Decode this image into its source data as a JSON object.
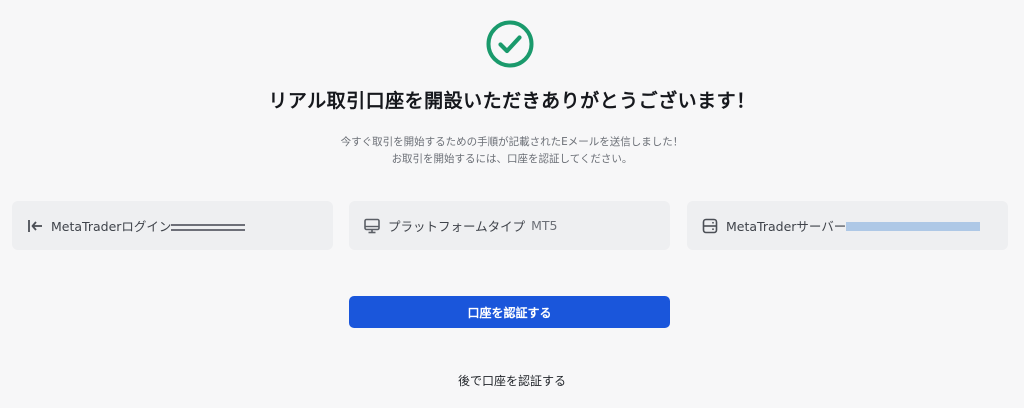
{
  "status": {
    "icon": "check-circle-icon",
    "color": "#1a9a6c"
  },
  "title": "リアル取引口座を開設いただきありがとうございます！",
  "subtitle": {
    "line1": "今すぐ取引を開始するための手順が記載されたEメールを送信しました！",
    "line2": "お取引を開始するには、口座を認証してください。"
  },
  "info_cards": [
    {
      "icon": "login-arrow-icon",
      "label": "MetaTraderログイン",
      "value": ""
    },
    {
      "icon": "monitor-icon",
      "label": "プラットフォームタイプ",
      "value": "MT5"
    },
    {
      "icon": "server-icon",
      "label": "MetaTraderサーバー",
      "value": ""
    }
  ],
  "actions": {
    "verify_label": "口座を認証する",
    "later_label": "後で口座を認証する"
  },
  "colors": {
    "primary": "#1a56db",
    "card_bg": "#eeeff1",
    "background": "#f7f7f8"
  }
}
